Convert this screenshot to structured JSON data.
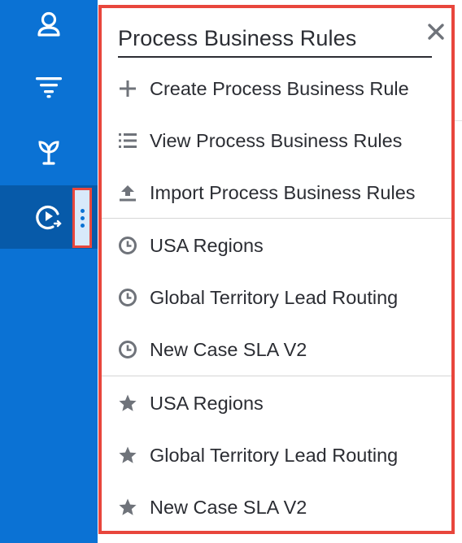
{
  "sidebar": {
    "items": [
      {
        "name": "contacts",
        "icon": "person-pin-icon"
      },
      {
        "name": "filter",
        "icon": "filter-icon"
      },
      {
        "name": "opportunities",
        "icon": "sprout-icon"
      },
      {
        "name": "process-business-rules",
        "icon": "play-clock-icon",
        "active": true
      }
    ],
    "more_icon": "kebab-icon"
  },
  "menu": {
    "title": "Process Business Rules",
    "close_icon": "close-icon",
    "actions": [
      {
        "label": "Create Process Business Rule",
        "icon": "plus-icon"
      },
      {
        "label": "View Process Business Rules",
        "icon": "list-icon"
      },
      {
        "label": "Import Process Business Rules",
        "icon": "upload-icon"
      }
    ],
    "recent": [
      {
        "label": "USA Regions",
        "icon": "clock-icon"
      },
      {
        "label": "Global Territory Lead Routing",
        "icon": "clock-icon"
      },
      {
        "label": "New Case SLA V2",
        "icon": "clock-icon"
      }
    ],
    "favorites": [
      {
        "label": "USA Regions",
        "icon": "star-icon"
      },
      {
        "label": "Global Territory Lead Routing",
        "icon": "star-icon"
      },
      {
        "label": "New Case SLA V2",
        "icon": "star-icon"
      }
    ]
  },
  "colors": {
    "sidebar": "#0b72d4",
    "sidebar_active": "#075aa9",
    "highlight": "#e8463c",
    "text": "#2b2d33",
    "icon_gray": "#6f737a"
  }
}
